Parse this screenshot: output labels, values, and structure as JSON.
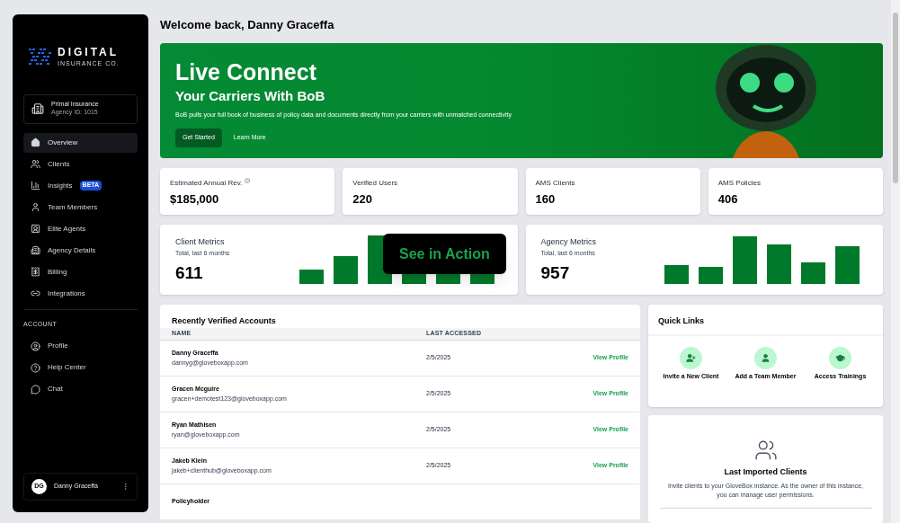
{
  "sidebar": {
    "logo": {
      "title": "DIGITAL",
      "subtitle": "INSURANCE CO."
    },
    "agency": {
      "name": "Primal Insurance",
      "id": "Agency ID: 1015"
    },
    "nav": [
      {
        "label": "Overview",
        "selected": true
      },
      {
        "label": "Clients",
        "selected": false
      },
      {
        "label": "Insights",
        "selected": false,
        "badge": "BETA"
      },
      {
        "label": "Team Members",
        "selected": false
      },
      {
        "label": "Elite Agents",
        "selected": false
      },
      {
        "label": "Agency Details",
        "selected": false
      },
      {
        "label": "Billing",
        "selected": false
      },
      {
        "label": "Integrations",
        "selected": false
      }
    ],
    "account_heading": "ACCOUNT",
    "account": [
      {
        "label": "Profile",
        "selected": false
      },
      {
        "label": "Help Center",
        "selected": false
      },
      {
        "label": "Chat",
        "selected": false
      }
    ],
    "user": {
      "initials": "DG",
      "name": "Danny Graceffa"
    }
  },
  "welcome": "Welcome back, Danny Graceffa",
  "banner": {
    "title": "Live Connect",
    "subtitle": "Your Carriers With BoB",
    "text": "BoB pulls your full book of business of policy data and documents directly from your carriers with unmatched connectivity",
    "primary": "Get Started",
    "secondary": "Learn More"
  },
  "stats": [
    {
      "label": "Estimated Annual Rev.",
      "value": "$185,000",
      "info": true
    },
    {
      "label": "Verified Users",
      "value": "220",
      "info": false
    },
    {
      "label": "AMS Clients",
      "value": "160",
      "info": false
    },
    {
      "label": "AMS Policies",
      "value": "406",
      "info": false
    }
  ],
  "metrics": [
    {
      "title": "Client Metrics",
      "subtitle": "Total, last 6 months",
      "value": "611"
    },
    {
      "title": "Agency Metrics",
      "subtitle": "Total, last 6 months",
      "value": "957"
    }
  ],
  "overlay": {
    "label": "See in Action"
  },
  "accounts": {
    "title": "Recently Verified Accounts",
    "columns": [
      "NAME",
      "LAST ACCESSED"
    ],
    "rows": [
      {
        "name": "Danny Graceffa",
        "email": "dannyg@gloveboxapp.com",
        "date": "2/5/2025",
        "action": "View Profile"
      },
      {
        "name": "Gracen Mcguire",
        "email": "gracen+demotest123@gloveboxapp.com",
        "date": "2/5/2025",
        "action": "View Profile"
      },
      {
        "name": "Ryan Mathisen",
        "email": "ryan@gloveboxapp.com",
        "date": "2/5/2025",
        "action": "View Profile"
      },
      {
        "name": "Jakeb Klein",
        "email": "jakeb+clienthub@gloveboxapp.com",
        "date": "2/5/2025",
        "action": "View Profile"
      },
      {
        "name": "Policyholder"
      }
    ]
  },
  "quick_links": {
    "title": "Quick Links",
    "items": [
      "Invite a New Client",
      "Add a Team Member",
      "Access Trainings"
    ]
  },
  "imported": {
    "title": "Last Imported Clients",
    "text": "Invite clients to your GloveBox instance. As the owner of this instance, you can manage user permissions."
  }
}
